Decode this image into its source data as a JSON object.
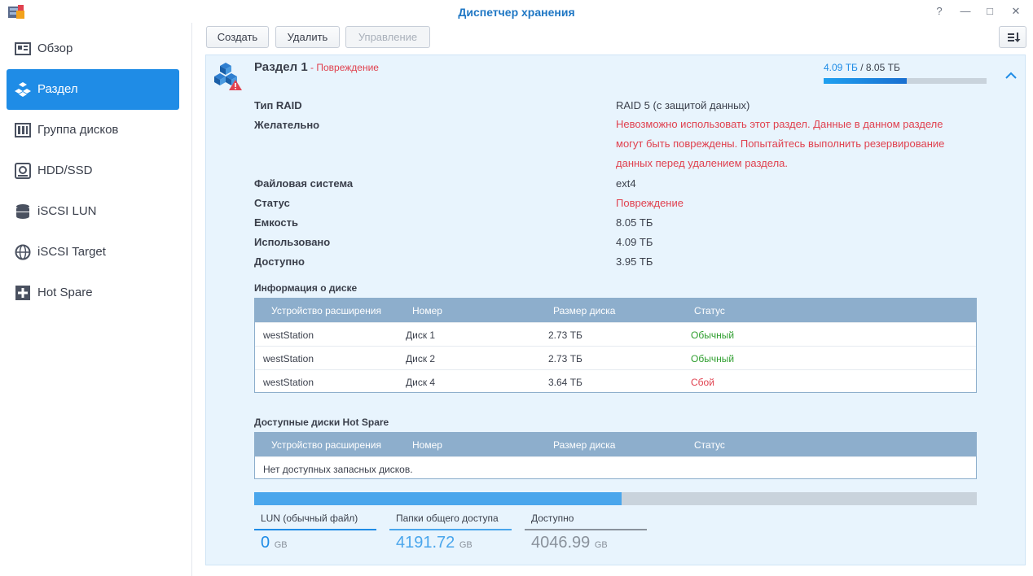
{
  "window": {
    "title": "Диспетчер хранения",
    "buttons": [
      "?",
      "—",
      "□",
      "✕"
    ]
  },
  "sidebar": {
    "items": [
      {
        "label": "Обзор",
        "icon": "overview-icon",
        "active": false
      },
      {
        "label": "Раздел",
        "icon": "volume-icon",
        "active": true
      },
      {
        "label": "Группа дисков",
        "icon": "disk-group-icon",
        "active": false
      },
      {
        "label": "HDD/SSD",
        "icon": "hdd-icon",
        "active": false
      },
      {
        "label": "iSCSI LUN",
        "icon": "database-icon",
        "active": false
      },
      {
        "label": "iSCSI Target",
        "icon": "globe-icon",
        "active": false
      },
      {
        "label": "Hot Spare",
        "icon": "plus-box-icon",
        "active": false
      }
    ]
  },
  "toolbar": {
    "create_label": "Создать",
    "delete_label": "Удалить",
    "manage_label": "Управление"
  },
  "volume": {
    "name": "Раздел 1",
    "separator": " - ",
    "state": "Повреждение",
    "used": "4.09 ТБ",
    "slash": " / ",
    "total": "8.05 ТБ",
    "usage_fraction": 0.508
  },
  "details": [
    {
      "label": "Тип RAID",
      "value": "RAID 5 (с защитой данных)",
      "red": false
    },
    {
      "label": "Желательно",
      "value": "Невозможно использовать этот раздел. Данные в данном разделе могут быть повреждены. Попытайтесь выполнить резервирование данных перед удалением раздела.",
      "red": true
    },
    {
      "label": "Файловая система",
      "value": "ext4",
      "red": false
    },
    {
      "label": "Статус",
      "value": "Повреждение",
      "red": true
    },
    {
      "label": "Емкость",
      "value": "8.05 ТБ",
      "red": false
    },
    {
      "label": "Использовано",
      "value": "4.09 ТБ",
      "red": false
    },
    {
      "label": "Доступно",
      "value": "3.95 ТБ",
      "red": false
    }
  ],
  "disk_info": {
    "title": "Информация о диске",
    "headers": [
      "Устройство расширения",
      "Номер",
      "Размер диска",
      "Статус"
    ],
    "rows": [
      {
        "device": "westStation",
        "number": "Диск 1",
        "size": "2.73 ТБ",
        "status": "Обычный",
        "ok": true
      },
      {
        "device": "westStation",
        "number": "Диск 2",
        "size": "2.73 ТБ",
        "status": "Обычный",
        "ok": true
      },
      {
        "device": "westStation",
        "number": "Диск 4",
        "size": "3.64 ТБ",
        "status": "Сбой",
        "ok": false
      }
    ]
  },
  "hot_spare": {
    "title": "Доступные диски Hot Spare",
    "headers": [
      "Устройство расширения",
      "Номер",
      "Размер диска",
      "Статус"
    ],
    "empty_text": "Нет доступных запасных дисков."
  },
  "capacity": {
    "fill_fraction": 0.508,
    "legend": [
      {
        "label": "LUN (обычный файл)",
        "value": "0",
        "unit": "GB",
        "color": "#1f8ce6"
      },
      {
        "label": "Папки общего доступа",
        "value": "4191.72",
        "unit": "GB",
        "color": "#4aa6ec"
      },
      {
        "label": "Доступно",
        "value": "4046.99",
        "unit": "GB",
        "color": "#8a929c"
      }
    ]
  },
  "colors": {
    "accent": "#1f8ce6",
    "error": "#e0414f",
    "ok": "#2e9e2e",
    "table_header": "#8daecc",
    "panel_bg": "#e8f4fd"
  }
}
